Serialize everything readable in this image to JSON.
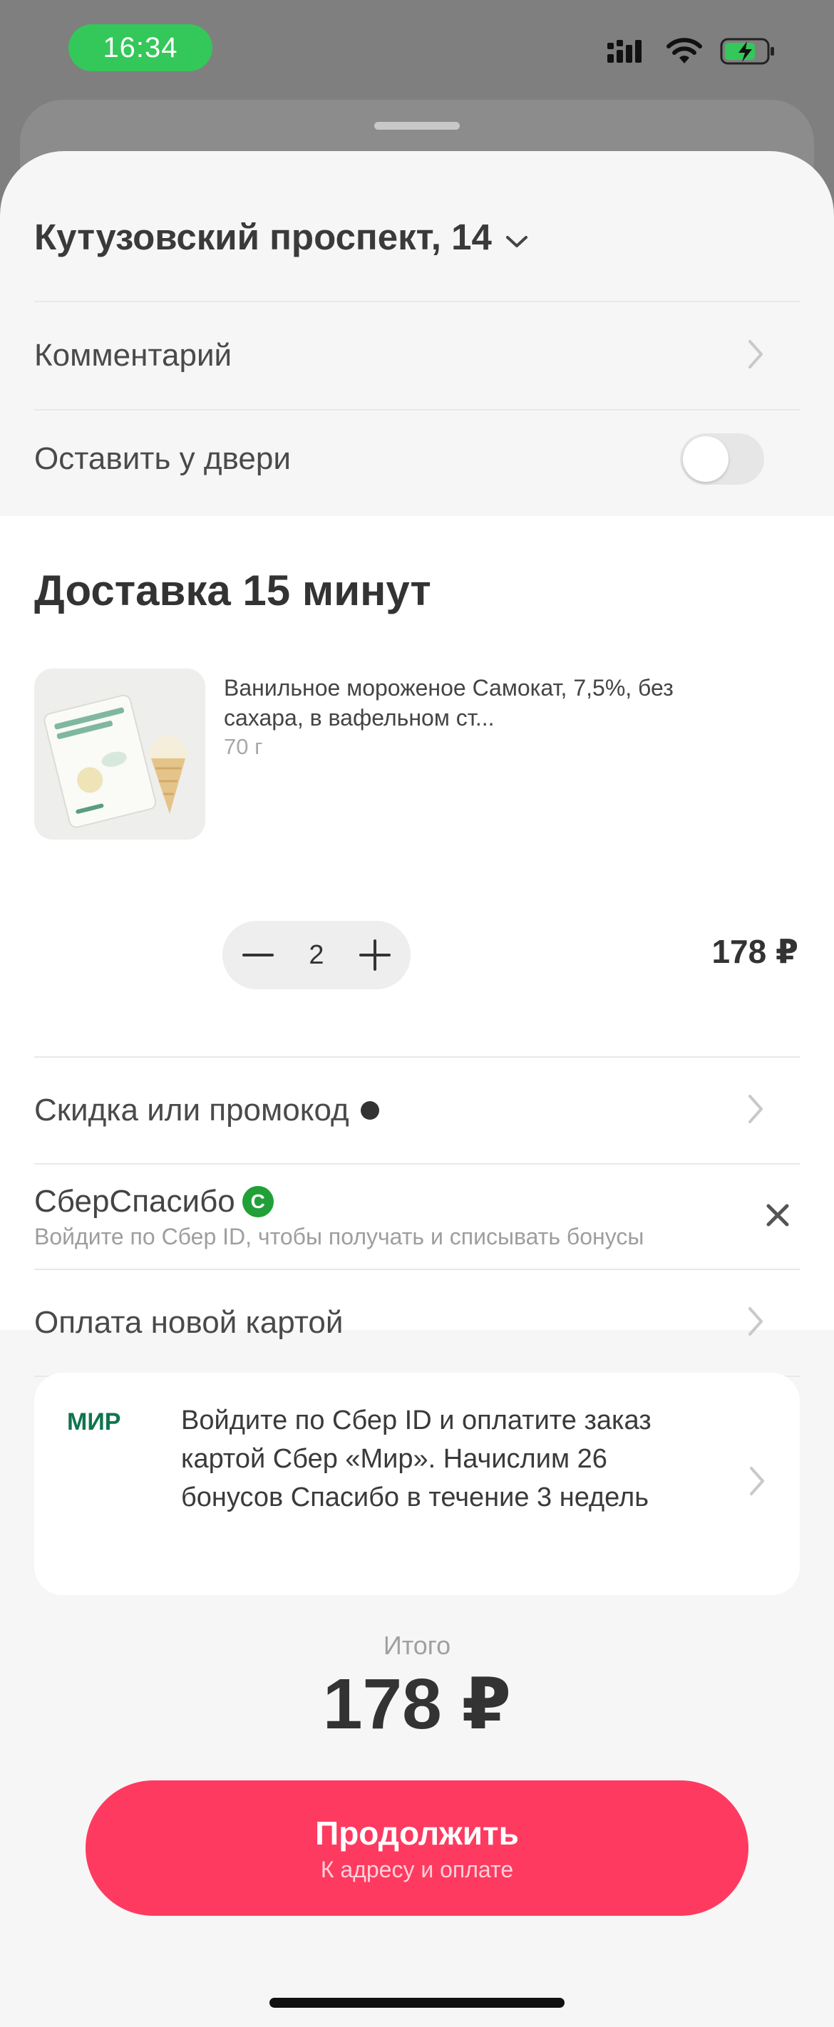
{
  "status_bar": {
    "time": "16:34",
    "icons": [
      "signal-icon",
      "wifi-icon",
      "battery-charging-icon"
    ]
  },
  "header": {
    "address": "Кутузовский проспект, 14",
    "address_icon": "chevron-down-icon"
  },
  "rows": {
    "comment": "Комментарий",
    "leave_at_door": "Оставить у двери",
    "leave_at_door_enabled": false
  },
  "delivery": {
    "title": "Доставка 15 минут",
    "product": {
      "name": "Ванильное мороженое Самокат, 7,5%, без сахара, в вафельном ст...",
      "weight": "70 г",
      "quantity": "2",
      "price": "178 ₽"
    }
  },
  "options": {
    "promo": "Скидка или промокод",
    "sber_title": "СберСпасибо",
    "sber_badge": "С",
    "sber_subtitle": "Войдите по Сбер ID, чтобы получать и списывать бонусы",
    "payment": "Оплата новой картой"
  },
  "mir_banner": {
    "logo_text": "МИР",
    "text": "Войдите по Сбер ID и оплатите заказ картой Сбер «Мир». Начислим 26 бонусов Спасибо в течение 3 недель"
  },
  "total": {
    "label": "Итого",
    "value": "178 ₽"
  },
  "cta": {
    "title": "Продолжить",
    "subtitle": "К адресу и оплате"
  },
  "colors": {
    "accent": "#fe3a60",
    "time_pill": "#34c759",
    "sber_green": "#21a038",
    "mir_green": "#0f754e",
    "mir_blue": "#00a3e0"
  }
}
